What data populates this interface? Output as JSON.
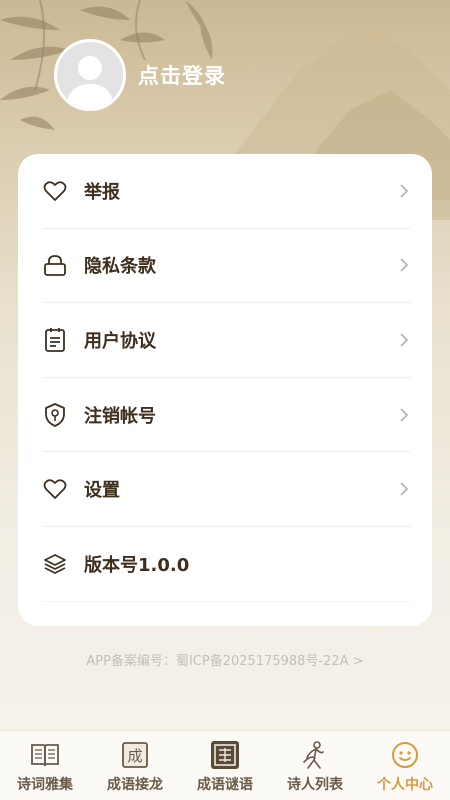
{
  "profile": {
    "login_text": "点击登录"
  },
  "menu": [
    {
      "label": "举报",
      "icon": "heart-icon"
    },
    {
      "label": "隐私条款",
      "icon": "lock-icon"
    },
    {
      "label": "用户协议",
      "icon": "document-icon"
    },
    {
      "label": "注销帐号",
      "icon": "shield-key-icon"
    },
    {
      "label": "设置",
      "icon": "heart-icon"
    },
    {
      "label": "版本号1.0.0",
      "icon": "layers-icon"
    }
  ],
  "footer": {
    "beian": "APP备案编号：蜀ICP备2025175988号-22A >"
  },
  "tabbar": [
    {
      "label": "诗词雅集",
      "icon": "book-icon"
    },
    {
      "label": "成语接龙",
      "icon": "seal-cheng-icon"
    },
    {
      "label": "成语谜语",
      "icon": "riddle-icon"
    },
    {
      "label": "诗人列表",
      "icon": "poet-figure-icon"
    },
    {
      "label": "个人中心",
      "icon": "smile-face-icon",
      "active": true
    }
  ],
  "colors": {
    "accent": "#d89a3a",
    "text": "#3e2f1f",
    "tab_text": "#6a5a47"
  }
}
